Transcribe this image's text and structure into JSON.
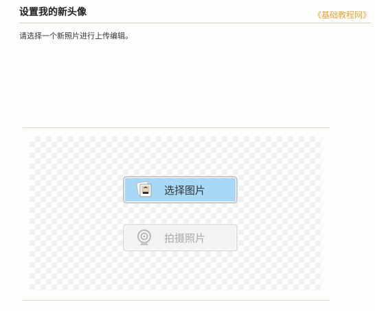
{
  "header": {
    "title": "设置我的新头像",
    "watermark": "《基础教程网》"
  },
  "instructions": "请选择一个新照片进行上传编辑。",
  "actions": {
    "select_image_label": "选择图片",
    "take_photo_label": "拍摄照片"
  },
  "icons": {
    "select_image": "photos-icon",
    "take_photo": "webcam-icon"
  },
  "colors": {
    "accent_button": "#a7d8f6",
    "watermark": "#e3a43a"
  }
}
